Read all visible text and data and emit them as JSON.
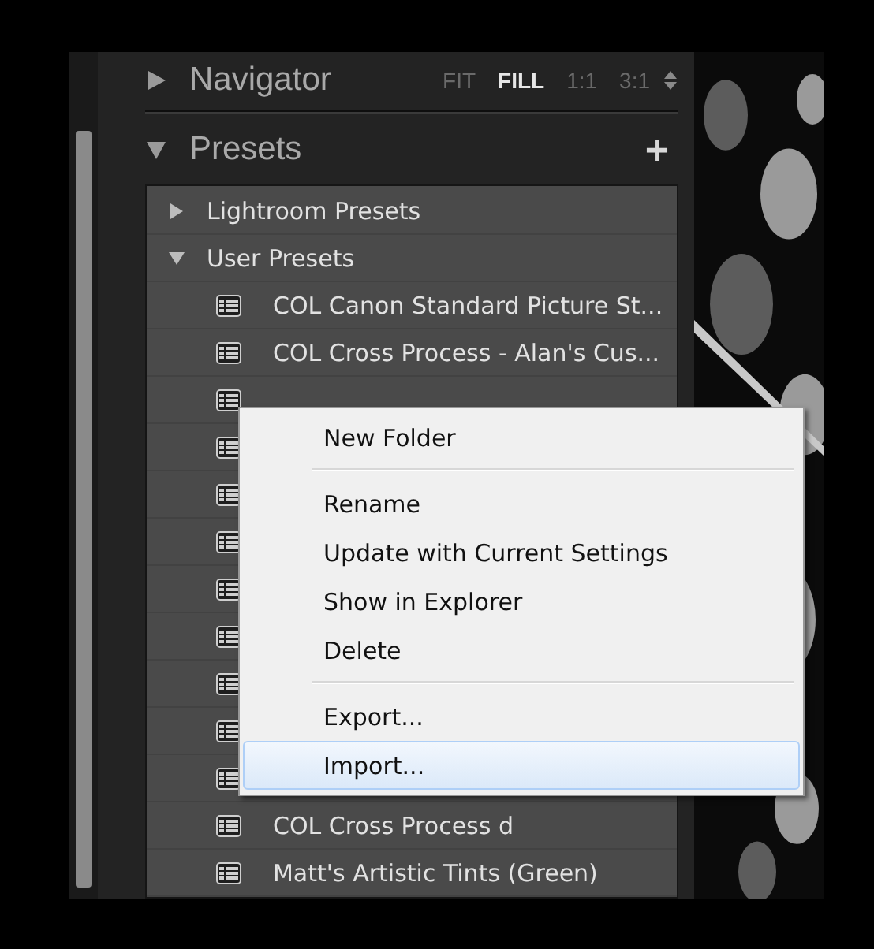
{
  "navigator": {
    "title": "Navigator",
    "expanded": false,
    "zoom_options": [
      {
        "label": "FIT",
        "selected": false
      },
      {
        "label": "FILL",
        "selected": true
      },
      {
        "label": "1:1",
        "selected": false
      },
      {
        "label": "3:1",
        "selected": false
      }
    ]
  },
  "presets": {
    "title": "Presets",
    "expanded": true,
    "add_label": "+",
    "folders": [
      {
        "name": "Lightroom Presets",
        "expanded": false
      },
      {
        "name": "User Presets",
        "expanded": true,
        "children": [
          {
            "kind": "preset",
            "name": "COL Canon Standard Picture St..."
          },
          {
            "kind": "preset",
            "name": "COL Cross Process - Alan's Cus..."
          },
          {
            "kind": "preset"
          },
          {
            "kind": "preset"
          },
          {
            "kind": "preset"
          },
          {
            "kind": "preset"
          },
          {
            "kind": "preset"
          },
          {
            "kind": "preset"
          },
          {
            "kind": "preset"
          },
          {
            "kind": "preset"
          },
          {
            "kind": "preset"
          },
          {
            "kind": "preset",
            "name": "COL Cross Process d"
          },
          {
            "kind": "preset",
            "name": "Matt's Artistic Tints (Green)"
          }
        ]
      }
    ]
  },
  "context_menu": {
    "groups": [
      [
        {
          "label": "New Folder",
          "selected": false
        }
      ],
      [
        {
          "label": "Rename",
          "selected": false
        },
        {
          "label": "Update with Current Settings",
          "selected": false
        },
        {
          "label": "Show in Explorer",
          "selected": false
        },
        {
          "label": "Delete",
          "selected": false
        }
      ],
      [
        {
          "label": "Export...",
          "selected": false
        },
        {
          "label": "Import...",
          "selected": true
        }
      ]
    ]
  }
}
